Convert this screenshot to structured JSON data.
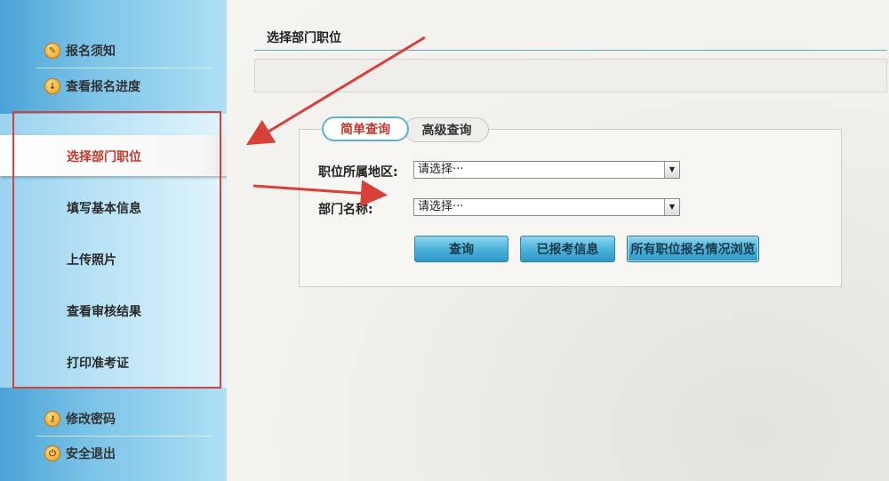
{
  "sidebar": {
    "top_items": [
      {
        "label": "报名须知",
        "icon": "pencil-icon"
      },
      {
        "label": "查看报名进度",
        "icon": "download-icon"
      }
    ],
    "menu_items": [
      {
        "label": "选择部门职位",
        "active": true
      },
      {
        "label": "填写基本信息"
      },
      {
        "label": "上传照片"
      },
      {
        "label": "查看审核结果"
      },
      {
        "label": "打印准考证"
      }
    ],
    "bottom_items": [
      {
        "label": "修改密码",
        "icon": "key-icon"
      },
      {
        "label": "安全退出",
        "icon": "power-icon"
      }
    ]
  },
  "main": {
    "title": "选择部门职位",
    "tabs": [
      {
        "label": "简单查询",
        "active": true
      },
      {
        "label": "高级查询"
      }
    ],
    "fields": [
      {
        "label": "职位所属地区:",
        "value": "请选择···"
      },
      {
        "label": "部门名称:",
        "value": "请选择···"
      }
    ],
    "buttons": {
      "query": "查询",
      "reported": "已报考信息",
      "all_positions": "所有职位报名情况浏览"
    }
  },
  "colors": {
    "accent_red": "#c0392b",
    "annotation_red": "#d8403a",
    "sidebar_blue": "#4aa3d6"
  }
}
